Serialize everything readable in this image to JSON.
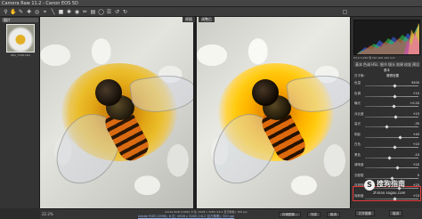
{
  "window": {
    "title": "Camera Raw 11.2 - Canon EOS 5D"
  },
  "toolbar": {
    "tools": [
      "zoom-icon",
      "hand-icon",
      "white-balance-icon",
      "color-sampler-icon",
      "targeted-adjust-icon",
      "crop-icon",
      "straighten-icon",
      "transform-icon",
      "spot-removal-icon",
      "red-eye-icon",
      "adjustment-brush-icon",
      "graduated-filter-icon",
      "radial-filter-icon",
      "preferences-icon",
      "rotate-ccw-icon",
      "rotate-cw-icon"
    ],
    "right_icons": [
      "fullscreen-icon"
    ]
  },
  "filmstrip": {
    "header": "图片",
    "thumbnail_label": "IMG_7348.CR2"
  },
  "canvas": {
    "before_label": "原图",
    "after_label": "调整后"
  },
  "statusbar": {
    "zoom": "22.2%",
    "coords": "Adobe RGB (1998); 8 位; 4928 x 3280 (16.2 百万像素); 300 ppi",
    "workflow_link": "Adobe RGB (1998); 8 位; 4928 x 3280 (16.2 百万像素); 300 ppi",
    "buttons": [
      "存储图像...",
      "完成",
      "取消"
    ]
  },
  "panel": {
    "histogram_colors": [
      "#ff3b3b",
      "#3bff5a",
      "#3b6bff",
      "#ffe23b",
      "#ff3bf2",
      "#3bf7ff"
    ],
    "camera_info": "f/5.6   1/250 秒   ISO 200   100 mm",
    "tabs": [
      "基本",
      "色调",
      "HSL",
      "细节",
      "镜头",
      "效果",
      "校准",
      "预设"
    ],
    "section_title": "基本",
    "white_balance_label": "白平衡:",
    "white_balance_value": "原照设置",
    "sliders": [
      {
        "label": "色温",
        "value": "5500"
      },
      {
        "label": "色调",
        "value": "+10"
      },
      {
        "label": "曝光",
        "value": "+0.20"
      },
      {
        "label": "对比度",
        "value": "+15"
      },
      {
        "label": "高光",
        "value": "-35"
      },
      {
        "label": "阴影",
        "value": "+40"
      },
      {
        "label": "白色",
        "value": "+10"
      },
      {
        "label": "黑色",
        "value": "-10"
      },
      {
        "label": "清晰度",
        "value": "+20"
      },
      {
        "label": "去朦胧",
        "value": "0"
      },
      {
        "label": "自然饱和度",
        "value": "+25"
      },
      {
        "label": "饱和度",
        "value": "+10"
      }
    ],
    "slider_positions": [
      0.55,
      0.55,
      0.53,
      0.57,
      0.4,
      0.65,
      0.55,
      0.45,
      0.6,
      0.5,
      0.63,
      0.55
    ],
    "bottom_buttons": [
      "打开图像",
      "取消"
    ]
  },
  "watermark": {
    "text": "搜狗指南",
    "sub": "zhinan.sogou.com"
  }
}
